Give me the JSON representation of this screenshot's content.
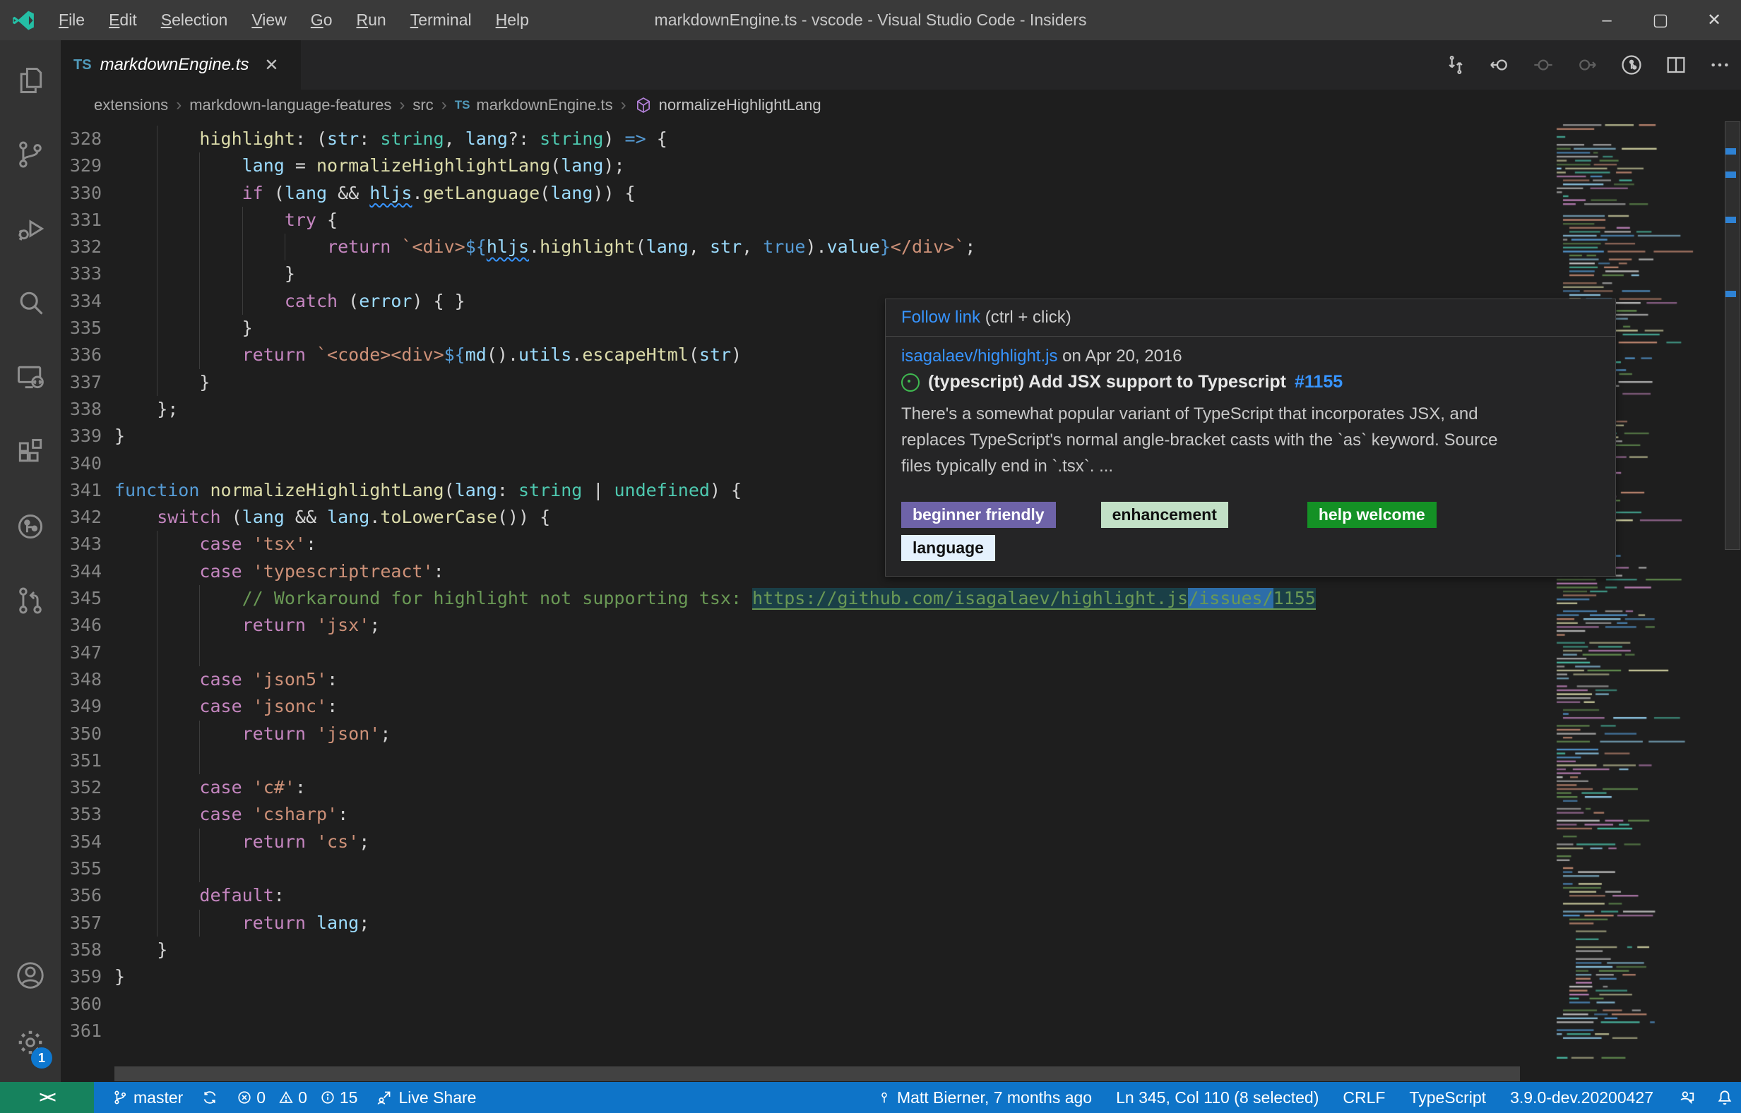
{
  "colors": {
    "titlebar": "#3a3a3a",
    "activitybar": "#333333",
    "tabbar": "#252526",
    "editor_bg": "#1e1e1e",
    "statusbar_blue": "#0e74c8",
    "remote_green": "#16825D",
    "popup_bg": "#252526",
    "popup_border": "#454545",
    "link_blue": "#3794FF",
    "comment_green": "#6A9955",
    "selection_blue": "#2d6da8",
    "open_issue_green": "#3FB950"
  },
  "window": {
    "title": "markdownEngine.ts - vscode - Visual Studio Code - Insiders",
    "menus": [
      "File",
      "Edit",
      "Selection",
      "View",
      "Go",
      "Run",
      "Terminal",
      "Help"
    ],
    "controls": {
      "minimize": "–",
      "maximize": "▢",
      "close": "✕"
    }
  },
  "activity_bar": {
    "items": [
      "explorer-icon",
      "source-control-icon",
      "run-and-debug-icon",
      "search-icon",
      "remote-explorer-icon",
      "extensions-icon",
      "github-icon",
      "pull-request-icon"
    ],
    "bottom_items": [
      "accounts-icon",
      "settings-gear-icon"
    ],
    "settings_badge": "1"
  },
  "tab": {
    "badge": "TS",
    "label": "markdownEngine.ts",
    "close": "✕"
  },
  "editor_actions": [
    "open-changes-icon",
    "previous-change-icon",
    "current-change-icon",
    "next-change-icon",
    "timeline-icon",
    "split-editor-icon",
    "more-actions-icon"
  ],
  "breadcrumbs": {
    "path": [
      "extensions",
      "markdown-language-features",
      "src"
    ],
    "file_badge": "TS",
    "file": "markdownEngine.ts",
    "symbol_icon": "symbol-function-cube-icon",
    "symbol": "normalizeHighlightLang",
    "separator": "›"
  },
  "editor": {
    "lines": [
      {
        "n": "328",
        "g": [
          4
        ],
        "s": [
          [
            "        ",
            "p"
          ],
          [
            "highlight",
            "fn"
          ],
          [
            ": (",
            "p"
          ],
          [
            "str",
            "v"
          ],
          [
            ": ",
            "p"
          ],
          [
            "string",
            "ty"
          ],
          [
            ", ",
            "p"
          ],
          [
            "lang",
            "v"
          ],
          [
            "?: ",
            "p"
          ],
          [
            "string",
            "ty"
          ],
          [
            ") ",
            "p"
          ],
          [
            "=>",
            "op"
          ],
          [
            " {",
            "p"
          ]
        ]
      },
      {
        "n": "329",
        "g": [
          4,
          8
        ],
        "s": [
          [
            "            ",
            "p"
          ],
          [
            "lang",
            "v"
          ],
          [
            " = ",
            "p"
          ],
          [
            "normalizeHighlightLang",
            "fn"
          ],
          [
            "(",
            "p"
          ],
          [
            "lang",
            "v"
          ],
          [
            ");",
            "p"
          ]
        ]
      },
      {
        "n": "330",
        "g": [
          4,
          8
        ],
        "s": [
          [
            "            ",
            "p"
          ],
          [
            "if",
            "kw"
          ],
          [
            " (",
            "p"
          ],
          [
            "lang",
            "v"
          ],
          [
            " && ",
            "p"
          ],
          [
            "hljs",
            "v sq"
          ],
          [
            ".",
            "p"
          ],
          [
            "getLanguage",
            "fn"
          ],
          [
            "(",
            "p"
          ],
          [
            "lang",
            "v"
          ],
          [
            ")) {",
            "p"
          ]
        ]
      },
      {
        "n": "331",
        "g": [
          4,
          8,
          12
        ],
        "s": [
          [
            "                ",
            "p"
          ],
          [
            "try",
            "kw"
          ],
          [
            " {",
            "p"
          ]
        ]
      },
      {
        "n": "332",
        "g": [
          4,
          8,
          12,
          16
        ],
        "s": [
          [
            "                    ",
            "p"
          ],
          [
            "return",
            "kw"
          ],
          [
            " ",
            "p"
          ],
          [
            "`<div>",
            "s"
          ],
          [
            "${",
            "tp"
          ],
          [
            "hljs",
            "v sq"
          ],
          [
            ".",
            "p"
          ],
          [
            "highlight",
            "fn"
          ],
          [
            "(",
            "p"
          ],
          [
            "lang",
            "v"
          ],
          [
            ", ",
            "p"
          ],
          [
            "str",
            "v"
          ],
          [
            ", ",
            "p"
          ],
          [
            "true",
            "dkw"
          ],
          [
            ").",
            "p"
          ],
          [
            "value",
            "v"
          ],
          [
            "}",
            "tp"
          ],
          [
            "</div>`",
            "s"
          ],
          [
            ";",
            "p"
          ]
        ]
      },
      {
        "n": "333",
        "g": [
          4,
          8,
          12
        ],
        "s": [
          [
            "                ",
            "p"
          ],
          [
            "}",
            "p"
          ]
        ]
      },
      {
        "n": "334",
        "g": [
          4,
          8,
          12
        ],
        "s": [
          [
            "                ",
            "p"
          ],
          [
            "catch",
            "kw"
          ],
          [
            " (",
            "p"
          ],
          [
            "error",
            "v"
          ],
          [
            ") { }",
            "p"
          ]
        ]
      },
      {
        "n": "335",
        "g": [
          4,
          8
        ],
        "s": [
          [
            "            ",
            "p"
          ],
          [
            "}",
            "p"
          ]
        ]
      },
      {
        "n": "336",
        "g": [
          4,
          8
        ],
        "s": [
          [
            "            ",
            "p"
          ],
          [
            "return",
            "kw"
          ],
          [
            " ",
            "p"
          ],
          [
            "`<code><div>",
            "s"
          ],
          [
            "${",
            "tp"
          ],
          [
            "md",
            "v"
          ],
          [
            "().",
            "p"
          ],
          [
            "utils",
            "v"
          ],
          [
            ".",
            "p"
          ],
          [
            "escapeHtml",
            "fn"
          ],
          [
            "(",
            "p"
          ],
          [
            "str",
            "v"
          ],
          [
            ")",
            "p"
          ]
        ]
      },
      {
        "n": "337",
        "g": [
          4
        ],
        "s": [
          [
            "        ",
            "p"
          ],
          [
            "}",
            "p"
          ]
        ]
      },
      {
        "n": "338",
        "g": [],
        "s": [
          [
            "    };",
            "p"
          ]
        ]
      },
      {
        "n": "339",
        "g": [],
        "s": [
          [
            "}",
            "p"
          ]
        ]
      },
      {
        "n": "340",
        "g": [],
        "s": []
      },
      {
        "n": "341",
        "g": [],
        "s": [
          [
            "function",
            "dkw"
          ],
          [
            " ",
            "p"
          ],
          [
            "normalizeHighlightLang",
            "fn"
          ],
          [
            "(",
            "p"
          ],
          [
            "lang",
            "v"
          ],
          [
            ": ",
            "p"
          ],
          [
            "string",
            "ty"
          ],
          [
            " | ",
            "p"
          ],
          [
            "undefined",
            "ty"
          ],
          [
            ") {",
            "p"
          ]
        ]
      },
      {
        "n": "342",
        "g": [],
        "s": [
          [
            "    ",
            "p"
          ],
          [
            "switch",
            "kw"
          ],
          [
            " (",
            "p"
          ],
          [
            "lang",
            "v"
          ],
          [
            " && ",
            "p"
          ],
          [
            "lang",
            "v"
          ],
          [
            ".",
            "p"
          ],
          [
            "toLowerCase",
            "fn"
          ],
          [
            "()) {",
            "p"
          ]
        ]
      },
      {
        "n": "343",
        "g": [
          4
        ],
        "s": [
          [
            "        ",
            "p"
          ],
          [
            "case",
            "kw"
          ],
          [
            " ",
            "p"
          ],
          [
            "'tsx'",
            "s"
          ],
          [
            ":",
            "p"
          ]
        ]
      },
      {
        "n": "344",
        "g": [
          4
        ],
        "s": [
          [
            "        ",
            "p"
          ],
          [
            "case",
            "kw"
          ],
          [
            " ",
            "p"
          ],
          [
            "'typescriptreact'",
            "s"
          ],
          [
            ":",
            "p"
          ]
        ]
      },
      {
        "n": "345",
        "g": [
          4,
          8
        ],
        "s": [
          [
            "            ",
            "p"
          ],
          [
            "// Workaround for highlight not supporting tsx: ",
            "com"
          ],
          [
            "https://github.com/isagalaev/highlight.js",
            "lnk"
          ],
          [
            "/issues/",
            "lnk sel"
          ],
          [
            "1155",
            "lnk"
          ]
        ]
      },
      {
        "n": "346",
        "g": [
          4,
          8
        ],
        "s": [
          [
            "            ",
            "p"
          ],
          [
            "return",
            "kw"
          ],
          [
            " ",
            "p"
          ],
          [
            "'jsx'",
            "s"
          ],
          [
            ";",
            "p"
          ]
        ]
      },
      {
        "n": "347",
        "g": [
          4,
          8
        ],
        "s": []
      },
      {
        "n": "348",
        "g": [
          4
        ],
        "s": [
          [
            "        ",
            "p"
          ],
          [
            "case",
            "kw"
          ],
          [
            " ",
            "p"
          ],
          [
            "'json5'",
            "s"
          ],
          [
            ":",
            "p"
          ]
        ]
      },
      {
        "n": "349",
        "g": [
          4
        ],
        "s": [
          [
            "        ",
            "p"
          ],
          [
            "case",
            "kw"
          ],
          [
            " ",
            "p"
          ],
          [
            "'jsonc'",
            "s"
          ],
          [
            ":",
            "p"
          ]
        ]
      },
      {
        "n": "350",
        "g": [
          4,
          8
        ],
        "s": [
          [
            "            ",
            "p"
          ],
          [
            "return",
            "kw"
          ],
          [
            " ",
            "p"
          ],
          [
            "'json'",
            "s"
          ],
          [
            ";",
            "p"
          ]
        ]
      },
      {
        "n": "351",
        "g": [
          4,
          8
        ],
        "s": []
      },
      {
        "n": "352",
        "g": [
          4
        ],
        "s": [
          [
            "        ",
            "p"
          ],
          [
            "case",
            "kw"
          ],
          [
            " ",
            "p"
          ],
          [
            "'c#'",
            "s"
          ],
          [
            ":",
            "p"
          ]
        ]
      },
      {
        "n": "353",
        "g": [
          4
        ],
        "s": [
          [
            "        ",
            "p"
          ],
          [
            "case",
            "kw"
          ],
          [
            " ",
            "p"
          ],
          [
            "'csharp'",
            "s"
          ],
          [
            ":",
            "p"
          ]
        ]
      },
      {
        "n": "354",
        "g": [
          4,
          8
        ],
        "s": [
          [
            "            ",
            "p"
          ],
          [
            "return",
            "kw"
          ],
          [
            " ",
            "p"
          ],
          [
            "'cs'",
            "s"
          ],
          [
            ";",
            "p"
          ]
        ]
      },
      {
        "n": "355",
        "g": [
          4,
          8
        ],
        "s": []
      },
      {
        "n": "356",
        "g": [
          4
        ],
        "s": [
          [
            "        ",
            "p"
          ],
          [
            "default",
            "kw"
          ],
          [
            ":",
            "p"
          ]
        ]
      },
      {
        "n": "357",
        "g": [
          4,
          8
        ],
        "s": [
          [
            "            ",
            "p"
          ],
          [
            "return",
            "kw"
          ],
          [
            " ",
            "p"
          ],
          [
            "lang",
            "v"
          ],
          [
            ";",
            "p"
          ]
        ]
      },
      {
        "n": "358",
        "g": [],
        "s": [
          [
            "    }",
            "p"
          ]
        ]
      },
      {
        "n": "359",
        "g": [],
        "s": [
          [
            "}",
            "p"
          ]
        ]
      },
      {
        "n": "360",
        "g": [],
        "s": []
      },
      {
        "n": "361",
        "g": [],
        "s": []
      }
    ],
    "overview_marks": [
      153,
      186,
      250,
      355
    ]
  },
  "popup": {
    "header": {
      "link": "Follow link",
      "hint": "(ctrl + click)"
    },
    "repo": "isagalaev/highlight.js",
    "date": " on Apr 20, 2016",
    "issue_icon": "open-issue-icon",
    "issue_title": "(typescript) Add JSX support to Typescript",
    "issue_number": "#1155",
    "description_lines": [
      "There's a somewhat popular variant of TypeScript that incorporates JSX, and",
      "replaces TypeScript's normal angle-bracket casts with the `as` keyword. Source",
      "files typically end in `.tsx`. ..."
    ],
    "labels": [
      {
        "text": "beginner friendly",
        "bg": "#6E63A8",
        "fg": "#ffffff"
      },
      {
        "text": "enhancement",
        "bg": "#C2E0C6",
        "fg": "#101010"
      },
      {
        "text": "help welcome",
        "bg": "#149125",
        "fg": "#ffffff"
      },
      {
        "text": "language",
        "bg": "#E4F1FD",
        "fg": "#101010"
      }
    ]
  },
  "status_bar": {
    "remote_indicator": "><",
    "branch": "master",
    "errors": "0",
    "warnings": "0",
    "infos": "15",
    "live_share": "Live Share",
    "blame": "Matt Bierner, 7 months ago",
    "cursor": "Ln 345, Col 110 (8 selected)",
    "eol": "CRLF",
    "language": "TypeScript",
    "version": "3.9.0-dev.20200427"
  }
}
